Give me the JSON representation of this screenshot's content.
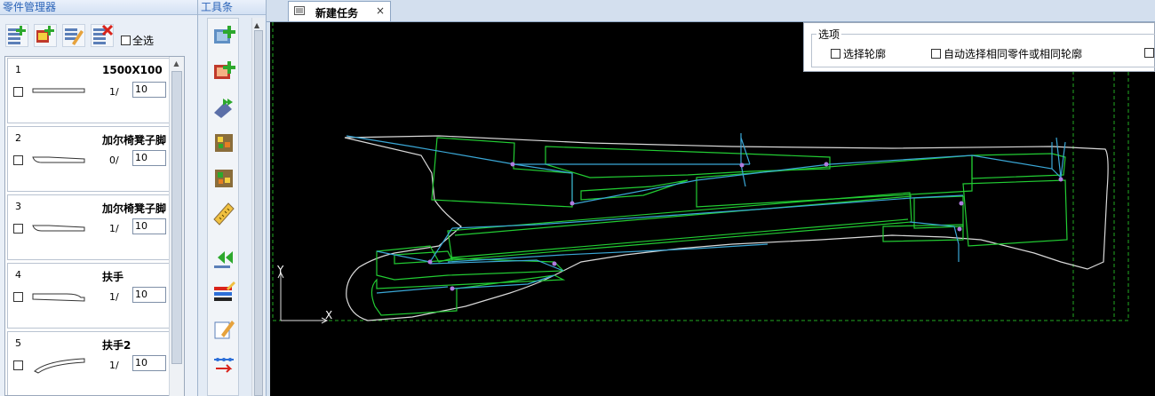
{
  "parts_panel": {
    "title": "零件管理器",
    "toolbar": [
      {
        "icon": "add-part-icon"
      },
      {
        "icon": "add-part-image-icon"
      },
      {
        "icon": "edit-part-icon"
      },
      {
        "icon": "delete-part-icon"
      }
    ],
    "select_all_label": "全选",
    "parts": [
      {
        "num": "1",
        "name": "1500X100",
        "qty_text": "1/",
        "qty_value": "10",
        "shape": "strip"
      },
      {
        "num": "2",
        "name": "加尔椅凳子脚",
        "qty_text": "0/",
        "qty_value": "10",
        "shape": "leg"
      },
      {
        "num": "3",
        "name": "加尔椅凳子脚",
        "qty_text": "1/",
        "qty_value": "10",
        "shape": "leg"
      },
      {
        "num": "4",
        "name": "扶手",
        "qty_text": "1/",
        "qty_value": "10",
        "shape": "armrest"
      },
      {
        "num": "5",
        "name": "扶手2",
        "qty_text": "1/",
        "qty_value": "10",
        "shape": "curve"
      }
    ]
  },
  "tool_panel": {
    "title": "工具条",
    "tools": [
      {
        "icon": "add-board-icon"
      },
      {
        "icon": "add-board-red-icon"
      },
      {
        "icon": "auto-nest-icon"
      },
      {
        "icon": "part-nest-icon"
      },
      {
        "icon": "part-nest-alt-icon"
      },
      {
        "icon": "ruler-icon"
      },
      {
        "icon": "rewind-icon"
      },
      {
        "icon": "layer-color-icon"
      },
      {
        "icon": "edit-path-icon"
      },
      {
        "icon": "cut-order-icon"
      }
    ]
  },
  "tab": {
    "label": "新建任务",
    "close": "×"
  },
  "options": {
    "legend": "选项",
    "select_contour_label": "选择轮廓",
    "auto_select_label": "自动选择相同零件或相同轮廓"
  },
  "canvas": {
    "axis_x_label": "X",
    "axis_y_label": "Y",
    "colors": {
      "part": "#22cc33",
      "path": "#3aa7d6",
      "board": "#d9d9d9",
      "marker": "#b07ce0",
      "frame": "#22aa22"
    }
  }
}
